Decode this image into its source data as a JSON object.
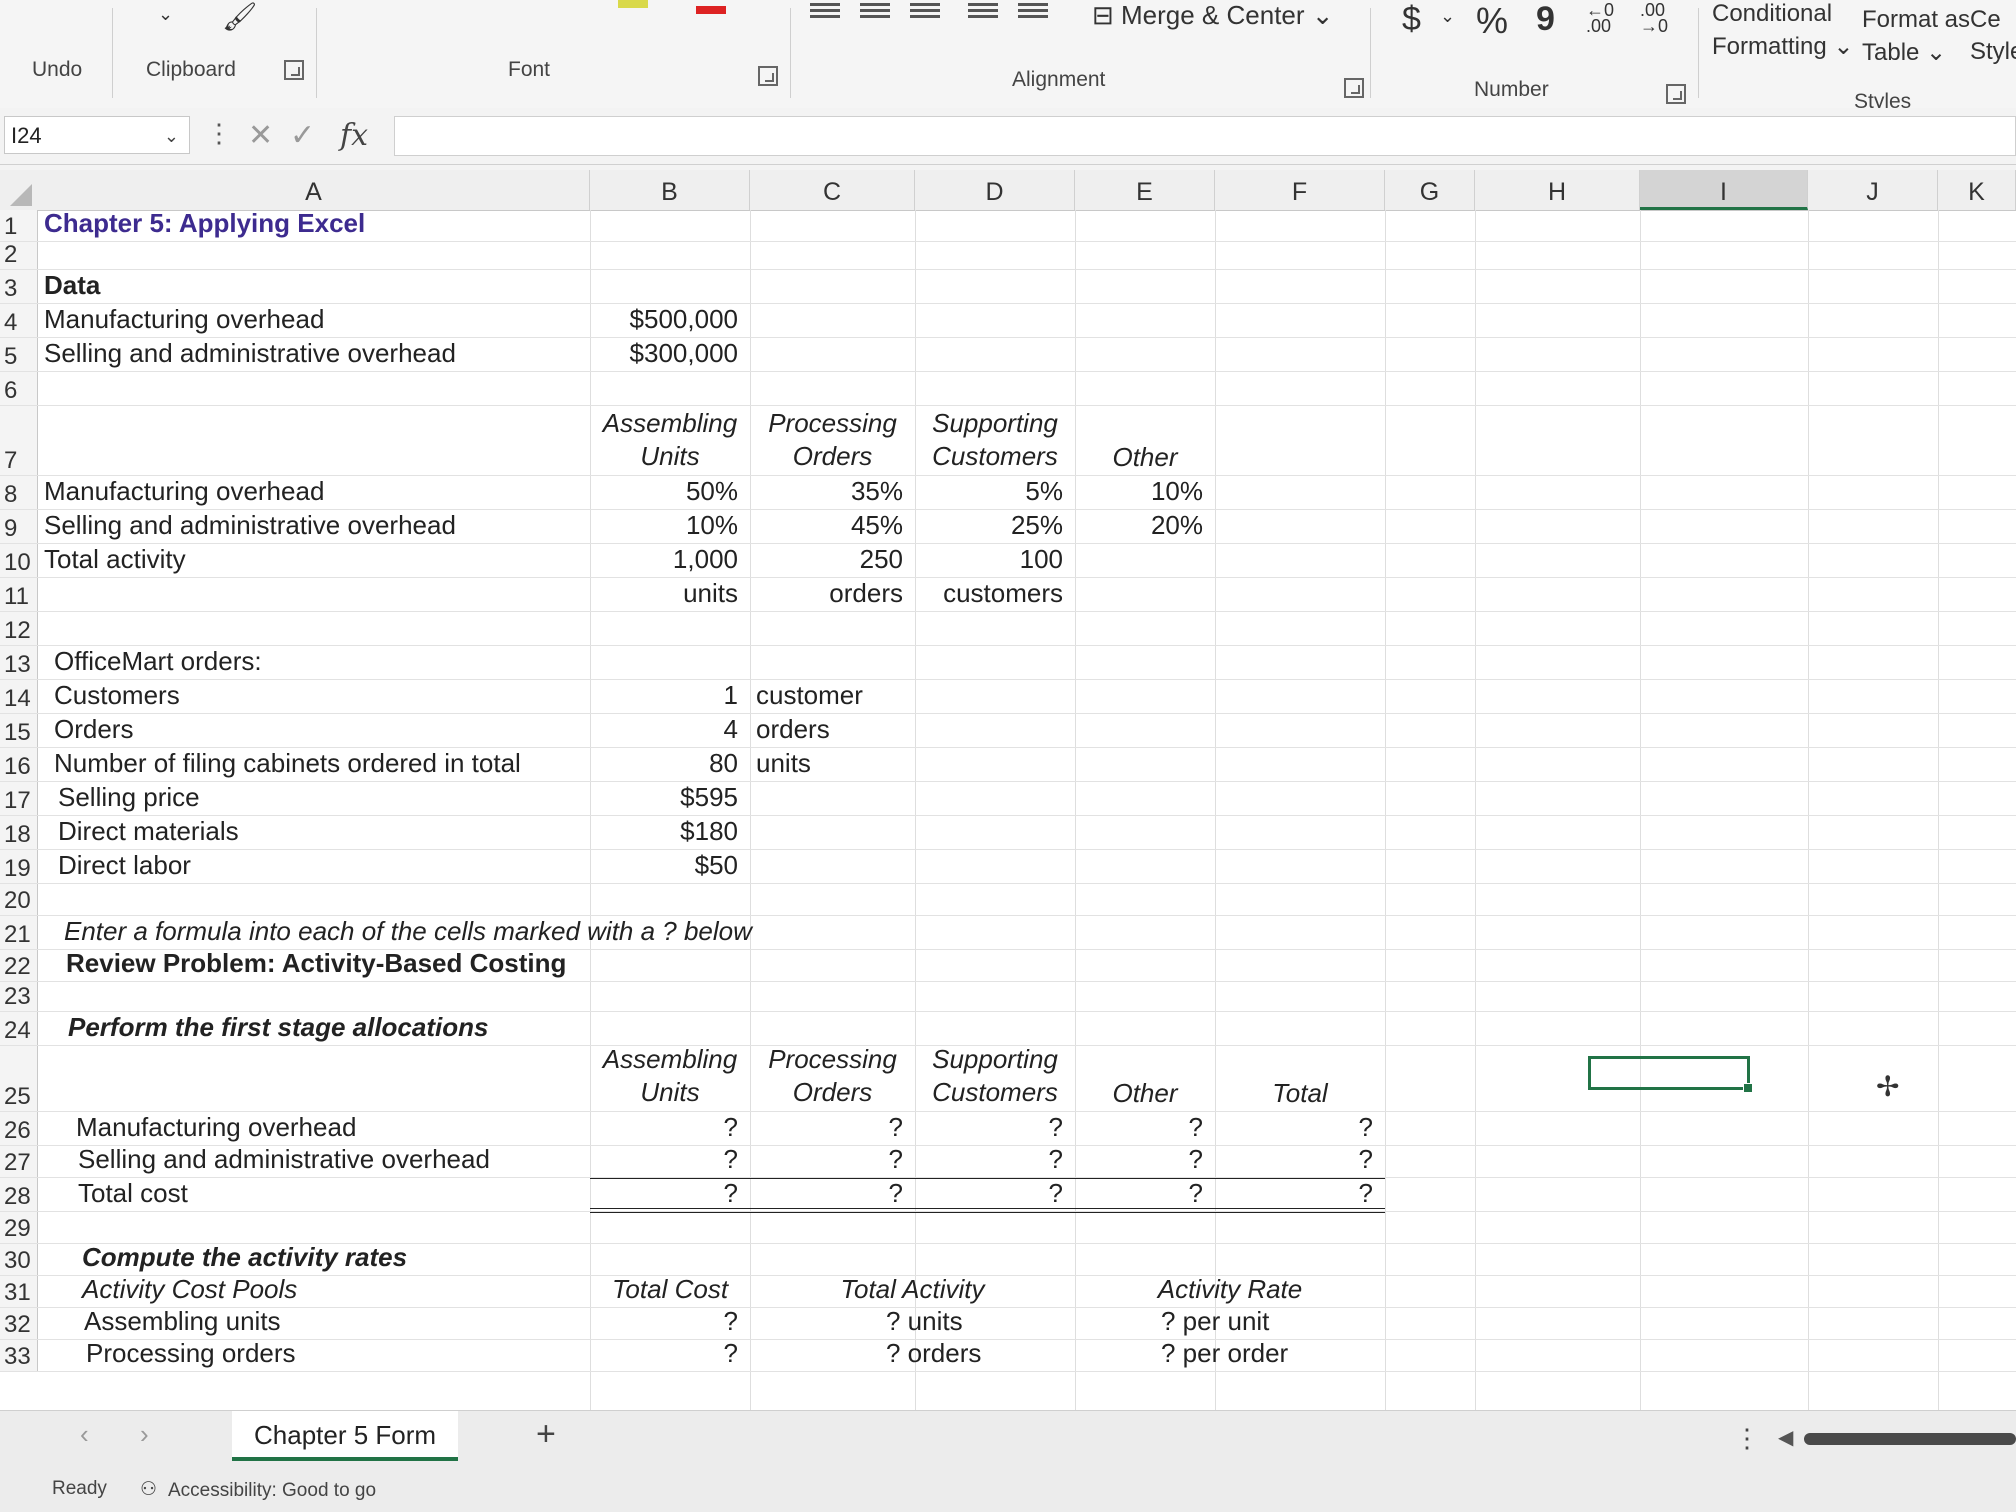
{
  "ribbon": {
    "undo": "Undo",
    "clipboard": "Clipboard",
    "font": "Font",
    "alignment": "Alignment",
    "merge_center": "Merge & Center",
    "number": "Number",
    "currency": "$",
    "percent": "%",
    "comma": "9",
    "inc_decimal": "←0 .00",
    "dec_decimal": ".00 →0",
    "conditional_formatting_1": "Conditional",
    "conditional_formatting_2": "Formatting",
    "format_as_table_1": "Format as",
    "format_as_table_2": "Table",
    "cell_styles_1": "Ce",
    "cell_styles_2": "Style",
    "styles": "Styles"
  },
  "formula_bar": {
    "name_box": "I24",
    "fx": "fx",
    "value": ""
  },
  "columns": [
    "A",
    "B",
    "C",
    "D",
    "E",
    "F",
    "G",
    "H",
    "I",
    "J",
    "K"
  ],
  "selected_column": "I",
  "cells": {
    "r1": {
      "num": "1",
      "a": "Chapter 5: Applying Excel"
    },
    "r2": {
      "num": "2"
    },
    "r3": {
      "num": "3",
      "a": "Data"
    },
    "r4": {
      "num": "4",
      "a": "Manufacturing overhead",
      "b": "$500,000"
    },
    "r5": {
      "num": "5",
      "a": "Selling and administrative overhead",
      "b": "$300,000"
    },
    "r6": {
      "num": "6"
    },
    "r7": {
      "num": "7",
      "b1": "Assembling",
      "b2": "Units",
      "c1": "Processing",
      "c2": "Orders",
      "d1": "Supporting",
      "d2": "Customers",
      "e": "Other"
    },
    "r8": {
      "num": "8",
      "a": "Manufacturing overhead",
      "b": "50%",
      "c": "35%",
      "d": "5%",
      "e": "10%"
    },
    "r9": {
      "num": "9",
      "a": "Selling and administrative overhead",
      "b": "10%",
      "c": "45%",
      "d": "25%",
      "e": "20%"
    },
    "r10": {
      "num": "10",
      "a": "Total activity",
      "b": "1,000",
      "c": "250",
      "d": "100"
    },
    "r11": {
      "num": "11",
      "b": "units",
      "c": "orders",
      "d": "customers"
    },
    "r12": {
      "num": "12"
    },
    "r13": {
      "num": "13",
      "a": "OfficeMart orders:"
    },
    "r14": {
      "num": "14",
      "a": "Customers",
      "b": "1",
      "c": "customer"
    },
    "r15": {
      "num": "15",
      "a": "Orders",
      "b": "4",
      "c": "orders"
    },
    "r16": {
      "num": "16",
      "a": "Number of filing cabinets ordered in total",
      "b": "80",
      "c": "units"
    },
    "r17": {
      "num": "17",
      "a": "Selling price",
      "b": "$595"
    },
    "r18": {
      "num": "18",
      "a": "Direct materials",
      "b": "$180"
    },
    "r19": {
      "num": "19",
      "a": "Direct labor",
      "b": "$50"
    },
    "r20": {
      "num": "20"
    },
    "r21": {
      "num": "21",
      "a": "Enter a formula into each of the cells marked with a ? below"
    },
    "r22": {
      "num": "22",
      "a": "Review Problem: Activity-Based Costing"
    },
    "r23": {
      "num": "23"
    },
    "r24": {
      "num": "24",
      "a": "Perform the first stage allocations"
    },
    "r25": {
      "num": "25",
      "b1": "Assembling",
      "b2": "Units",
      "c1": "Processing",
      "c2": "Orders",
      "d1": "Supporting",
      "d2": "Customers",
      "e": "Other",
      "f": "Total"
    },
    "r26": {
      "num": "26",
      "a": "Manufacturing overhead",
      "b": "?",
      "c": "?",
      "d": "?",
      "e": "?",
      "f": "?"
    },
    "r27": {
      "num": "27",
      "a": "Selling and administrative overhead",
      "b": "?",
      "c": "?",
      "d": "?",
      "e": "?",
      "f": "?"
    },
    "r28": {
      "num": "28",
      "a": "Total cost",
      "b": "?",
      "c": "?",
      "d": "?",
      "e": "?",
      "f": "?"
    },
    "r29": {
      "num": "29"
    },
    "r30": {
      "num": "30",
      "a": "Compute the activity rates"
    },
    "r31": {
      "num": "31",
      "a": "Activity Cost Pools",
      "b": "Total Cost",
      "c": "Total Activity",
      "e": "Activity Rate"
    },
    "r32": {
      "num": "32",
      "a": "Assembling units",
      "b": "?",
      "c": "? units",
      "e": "? per unit"
    },
    "r33": {
      "num": "33",
      "a": "Processing orders",
      "b": "?",
      "c": "? orders",
      "e": "? per order"
    }
  },
  "sheet_tab": "Chapter 5 Form",
  "add_sheet": "+",
  "status": {
    "ready": "Ready",
    "accessibility": "Accessibility: Good to go"
  }
}
